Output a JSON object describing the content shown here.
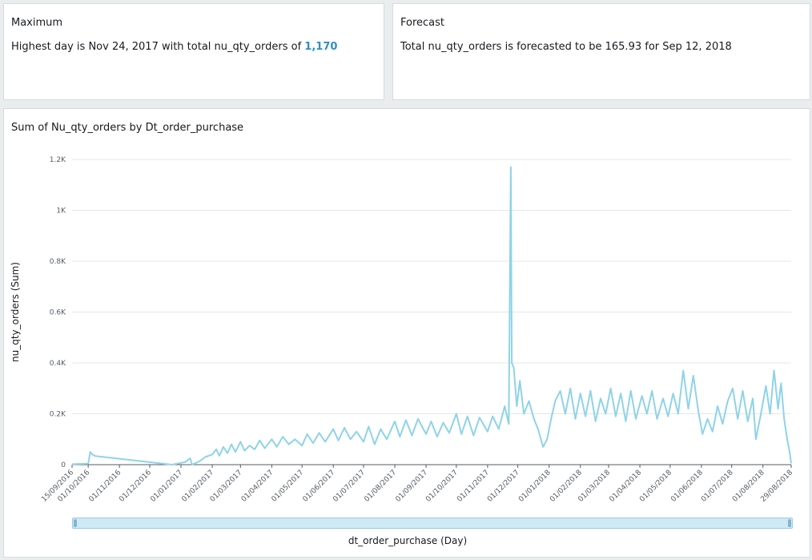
{
  "maximum": {
    "title": "Maximum",
    "text_prefix": "Highest day is Nov 24, 2017 with total nu_qty_orders of ",
    "value": "1,170"
  },
  "forecast": {
    "title": "Forecast",
    "text": "Total nu_qty_orders is forecasted to be 165.93 for Sep 12, 2018"
  },
  "colors": {
    "line": "#8fd3e8",
    "highlight": "#2e8ec7",
    "grid": "#e4e7e8"
  },
  "chart_data": {
    "type": "line",
    "title": "Sum of Nu_qty_orders by Dt_order_purchase",
    "xlabel": "dt_order_purchase (Day)",
    "ylabel": "nu_qty_orders (Sum)",
    "ylim": [
      0,
      1200
    ],
    "yticks": [
      {
        "value": 0,
        "label": "0"
      },
      {
        "value": 200,
        "label": "0.2K"
      },
      {
        "value": 400,
        "label": "0.4K"
      },
      {
        "value": 600,
        "label": "0.6K"
      },
      {
        "value": 800,
        "label": "0.8K"
      },
      {
        "value": 1000,
        "label": "1K"
      },
      {
        "value": 1200,
        "label": "1.2K"
      }
    ],
    "xrange": [
      "2016-09-15",
      "2018-08-29"
    ],
    "xticks": [
      "15/09/2016",
      "01/10/2016",
      "01/11/2016",
      "01/12/2016",
      "01/01/2017",
      "01/02/2017",
      "01/03/2017",
      "01/04/2017",
      "01/05/2017",
      "01/06/2017",
      "01/07/2017",
      "01/08/2017",
      "01/09/2017",
      "01/10/2017",
      "01/11/2017",
      "01/12/2017",
      "01/01/2018",
      "01/02/2018",
      "01/03/2018",
      "01/04/2018",
      "01/05/2018",
      "01/06/2018",
      "01/07/2018",
      "01/08/2018",
      "29/08/2018"
    ],
    "grid": true,
    "series": [
      {
        "points": [
          [
            "2016-09-15",
            2
          ],
          [
            "2016-10-01",
            4
          ],
          [
            "2016-10-03",
            50
          ],
          [
            "2016-10-05",
            40
          ],
          [
            "2016-10-08",
            34
          ],
          [
            "2016-12-23",
            0
          ],
          [
            "2017-01-05",
            10
          ],
          [
            "2017-01-10",
            25
          ],
          [
            "2017-01-12",
            0
          ],
          [
            "2017-01-15",
            5
          ],
          [
            "2017-01-20",
            15
          ],
          [
            "2017-01-25",
            30
          ],
          [
            "2017-02-01",
            40
          ],
          [
            "2017-02-05",
            60
          ],
          [
            "2017-02-08",
            35
          ],
          [
            "2017-02-12",
            70
          ],
          [
            "2017-02-16",
            45
          ],
          [
            "2017-02-20",
            80
          ],
          [
            "2017-02-24",
            50
          ],
          [
            "2017-03-01",
            90
          ],
          [
            "2017-03-05",
            55
          ],
          [
            "2017-03-10",
            75
          ],
          [
            "2017-03-15",
            60
          ],
          [
            "2017-03-20",
            95
          ],
          [
            "2017-03-25",
            65
          ],
          [
            "2017-04-01",
            100
          ],
          [
            "2017-04-06",
            70
          ],
          [
            "2017-04-12",
            110
          ],
          [
            "2017-04-18",
            80
          ],
          [
            "2017-04-24",
            100
          ],
          [
            "2017-05-01",
            75
          ],
          [
            "2017-05-06",
            120
          ],
          [
            "2017-05-12",
            85
          ],
          [
            "2017-05-18",
            125
          ],
          [
            "2017-05-24",
            90
          ],
          [
            "2017-06-01",
            140
          ],
          [
            "2017-06-06",
            95
          ],
          [
            "2017-06-12",
            145
          ],
          [
            "2017-06-18",
            100
          ],
          [
            "2017-06-24",
            130
          ],
          [
            "2017-07-01",
            90
          ],
          [
            "2017-07-06",
            150
          ],
          [
            "2017-07-12",
            80
          ],
          [
            "2017-07-18",
            140
          ],
          [
            "2017-07-24",
            100
          ],
          [
            "2017-08-01",
            170
          ],
          [
            "2017-08-06",
            110
          ],
          [
            "2017-08-12",
            175
          ],
          [
            "2017-08-18",
            115
          ],
          [
            "2017-08-24",
            180
          ],
          [
            "2017-09-01",
            120
          ],
          [
            "2017-09-06",
            170
          ],
          [
            "2017-09-12",
            110
          ],
          [
            "2017-09-18",
            165
          ],
          [
            "2017-09-24",
            125
          ],
          [
            "2017-10-01",
            200
          ],
          [
            "2017-10-06",
            120
          ],
          [
            "2017-10-12",
            190
          ],
          [
            "2017-10-18",
            115
          ],
          [
            "2017-10-24",
            185
          ],
          [
            "2017-11-01",
            130
          ],
          [
            "2017-11-06",
            190
          ],
          [
            "2017-11-12",
            140
          ],
          [
            "2017-11-18",
            230
          ],
          [
            "2017-11-22",
            160
          ],
          [
            "2017-11-24",
            1170
          ],
          [
            "2017-11-25",
            400
          ],
          [
            "2017-11-27",
            380
          ],
          [
            "2017-11-30",
            230
          ],
          [
            "2017-12-03",
            330
          ],
          [
            "2017-12-07",
            200
          ],
          [
            "2017-12-12",
            250
          ],
          [
            "2017-12-17",
            180
          ],
          [
            "2017-12-21",
            140
          ],
          [
            "2017-12-26",
            70
          ],
          [
            "2017-12-30",
            100
          ],
          [
            "2018-01-03",
            180
          ],
          [
            "2018-01-07",
            250
          ],
          [
            "2018-01-12",
            290
          ],
          [
            "2018-01-17",
            200
          ],
          [
            "2018-01-22",
            300
          ],
          [
            "2018-01-27",
            180
          ],
          [
            "2018-02-01",
            280
          ],
          [
            "2018-02-06",
            190
          ],
          [
            "2018-02-11",
            290
          ],
          [
            "2018-02-16",
            170
          ],
          [
            "2018-02-21",
            260
          ],
          [
            "2018-02-26",
            200
          ],
          [
            "2018-03-03",
            300
          ],
          [
            "2018-03-08",
            190
          ],
          [
            "2018-03-13",
            280
          ],
          [
            "2018-03-18",
            170
          ],
          [
            "2018-03-23",
            290
          ],
          [
            "2018-03-28",
            180
          ],
          [
            "2018-04-03",
            270
          ],
          [
            "2018-04-08",
            200
          ],
          [
            "2018-04-13",
            290
          ],
          [
            "2018-04-18",
            180
          ],
          [
            "2018-04-24",
            260
          ],
          [
            "2018-04-29",
            190
          ],
          [
            "2018-05-04",
            280
          ],
          [
            "2018-05-09",
            200
          ],
          [
            "2018-05-14",
            370
          ],
          [
            "2018-05-19",
            220
          ],
          [
            "2018-05-24",
            350
          ],
          [
            "2018-05-29",
            210
          ],
          [
            "2018-06-02",
            120
          ],
          [
            "2018-06-07",
            180
          ],
          [
            "2018-06-12",
            130
          ],
          [
            "2018-06-17",
            230
          ],
          [
            "2018-06-22",
            160
          ],
          [
            "2018-06-27",
            250
          ],
          [
            "2018-07-02",
            300
          ],
          [
            "2018-07-07",
            180
          ],
          [
            "2018-07-12",
            290
          ],
          [
            "2018-07-17",
            170
          ],
          [
            "2018-07-22",
            260
          ],
          [
            "2018-07-25",
            100
          ],
          [
            "2018-07-30",
            200
          ],
          [
            "2018-08-04",
            310
          ],
          [
            "2018-08-08",
            200
          ],
          [
            "2018-08-12",
            370
          ],
          [
            "2018-08-16",
            220
          ],
          [
            "2018-08-19",
            320
          ],
          [
            "2018-08-22",
            180
          ],
          [
            "2018-08-25",
            100
          ],
          [
            "2018-08-27",
            60
          ],
          [
            "2018-08-29",
            5
          ]
        ]
      }
    ]
  }
}
